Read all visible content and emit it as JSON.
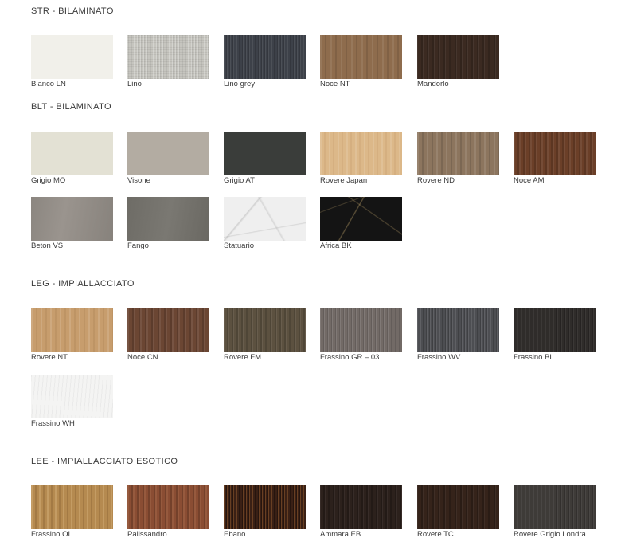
{
  "sections": [
    {
      "title": "STR - BILAMINATO",
      "items": [
        {
          "label": "Bianco LN",
          "color": "#f1f0ea"
        },
        {
          "label": "Lino",
          "color": "#c6c5bf"
        },
        {
          "label": "Lino grey",
          "color": "#3d4149"
        },
        {
          "label": "Noce NT",
          "color": "#8e6c4d"
        },
        {
          "label": "Mandorlo",
          "color": "#3b2a21"
        }
      ]
    },
    {
      "title": "BLT - BILAMINATO",
      "items": [
        {
          "label": "Grigio MO",
          "color": "#e3e1d4"
        },
        {
          "label": "Visone",
          "color": "#b3aca2"
        },
        {
          "label": "Grigio AT",
          "color": "#3a3d3a"
        },
        {
          "label": "Rovere Japan",
          "color": "#dcb889"
        },
        {
          "label": "Rovere ND",
          "color": "#8c755e"
        },
        {
          "label": "Noce AM",
          "color": "#6b3f28"
        },
        {
          "label": "Beton VS",
          "color": "#8b8680"
        },
        {
          "label": "Fango",
          "color": "#6e6c66"
        },
        {
          "label": "Statuario",
          "color": "#efefef"
        },
        {
          "label": "Africa BK",
          "color": "#141414"
        }
      ]
    },
    {
      "title": "LEG - IMPIALLACCIATO",
      "items": [
        {
          "label": "Rovere NT",
          "color": "#c79d6d"
        },
        {
          "label": "Noce CN",
          "color": "#6b4633"
        },
        {
          "label": "Rovere FM",
          "color": "#5c5140"
        },
        {
          "label": "Frassino GR – 03",
          "color": "#726a66"
        },
        {
          "label": "Frassino WV",
          "color": "#4d4e52"
        },
        {
          "label": "Frassino BL",
          "color": "#2f2c2a"
        },
        {
          "label": "Frassino WH",
          "color": "#f4f4f3"
        }
      ]
    },
    {
      "title": "LEE - IMPIALLACCIATO ESOTICO",
      "items": [
        {
          "label": "Frassino OL",
          "color": "#b58a50"
        },
        {
          "label": "Palissandro",
          "color": "#8a4d33"
        },
        {
          "label": "Ebano",
          "color": "#3a2015"
        },
        {
          "label": "Ammara EB",
          "color": "#2c211c"
        },
        {
          "label": "Rovere TC",
          "color": "#35231a"
        },
        {
          "label": "Rovere Grigio Londra",
          "color": "#3e3b38"
        }
      ]
    }
  ]
}
